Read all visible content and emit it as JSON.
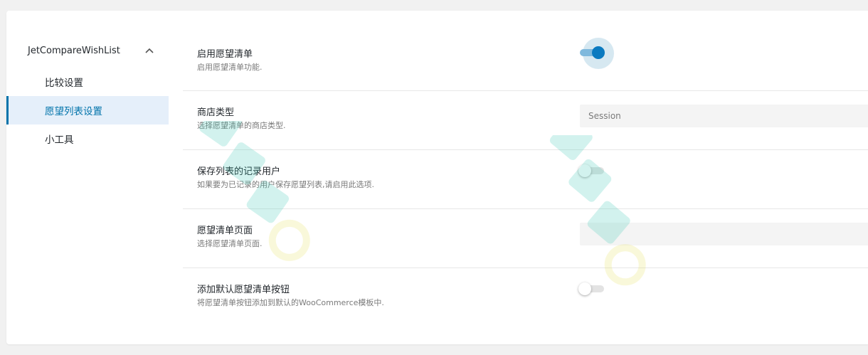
{
  "sidebar": {
    "header": "JetCompareWishList",
    "items": [
      {
        "label": "比较设置"
      },
      {
        "label": "愿望列表设置"
      },
      {
        "label": "小工具"
      }
    ]
  },
  "settings": {
    "enable": {
      "label": "启用愿望清单",
      "description": "启用愿望清单功能.",
      "state": "on"
    },
    "store_type": {
      "label": "商店类型",
      "description": "选择愿望清单的商店类型.",
      "value": "Session"
    },
    "save_for_users": {
      "label": "保存列表的记录用户",
      "description": "如果要为已记录的用户保存愿望列表,请启用此选项.",
      "state": "off"
    },
    "page": {
      "label": "愿望清单页面",
      "description": "选择愿望清单页面.",
      "value": ""
    },
    "default_button": {
      "label": "添加默认愿望清单按钮",
      "description": "将愿望清单按钮添加到默认的WooCommerce模板中.",
      "state": "off"
    }
  },
  "colors": {
    "accent": "#0073aa",
    "active_bg": "#e5effa"
  },
  "icons": {
    "collapse": "chevron-up-icon"
  }
}
